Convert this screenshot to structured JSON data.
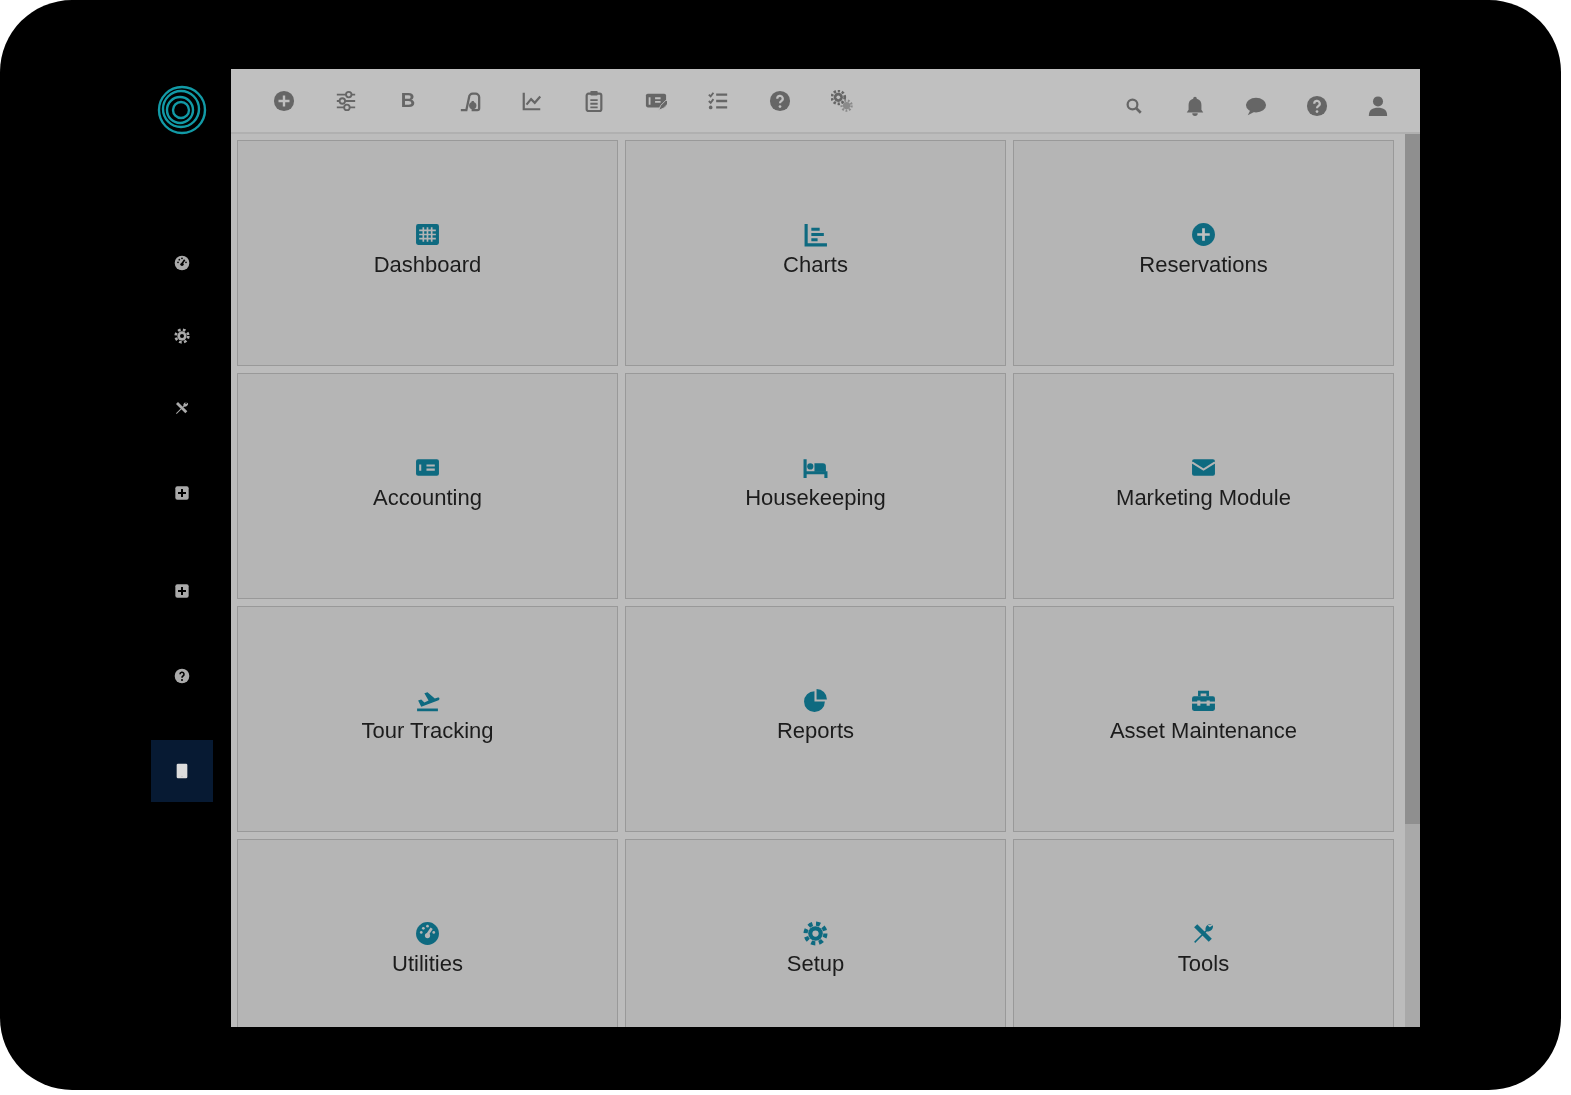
{
  "sidebar": {
    "items": [
      {
        "selected": false
      },
      {
        "selected": false
      },
      {
        "selected": false
      },
      {
        "selected": false
      },
      {
        "selected": false
      },
      {
        "selected": false
      },
      {
        "selected": true
      }
    ]
  },
  "toolbar": {
    "letter_button": "B"
  },
  "tiles": [
    {
      "label": "Dashboard"
    },
    {
      "label": "Charts"
    },
    {
      "label": "Reservations"
    },
    {
      "label": "Accounting"
    },
    {
      "label": "Housekeeping"
    },
    {
      "label": "Marketing Module"
    },
    {
      "label": "Tour Tracking"
    },
    {
      "label": "Reports"
    },
    {
      "label": "Asset Maintenance"
    },
    {
      "label": "Utilities"
    },
    {
      "label": "Setup"
    },
    {
      "label": "Tools"
    }
  ]
}
